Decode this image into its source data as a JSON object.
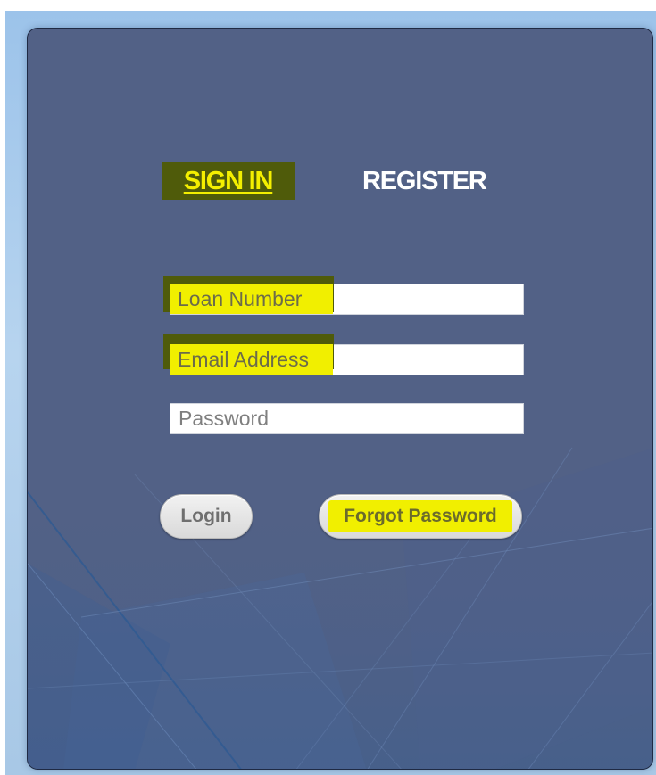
{
  "auth": {
    "tabs": {
      "sign_in": "SIGN IN",
      "register": "REGISTER"
    },
    "fields": {
      "loan_number": {
        "placeholder": "Loan Number"
      },
      "email": {
        "placeholder": "Email Address"
      },
      "password": {
        "placeholder": "Password"
      }
    },
    "buttons": {
      "login": "Login",
      "forgot_password": "Forgot Password"
    }
  },
  "colors": {
    "panel": "#526186",
    "highlight": "#f1ef00",
    "highlight_dark": "#4f5b0a",
    "backdrop": "#9cc3ea"
  }
}
